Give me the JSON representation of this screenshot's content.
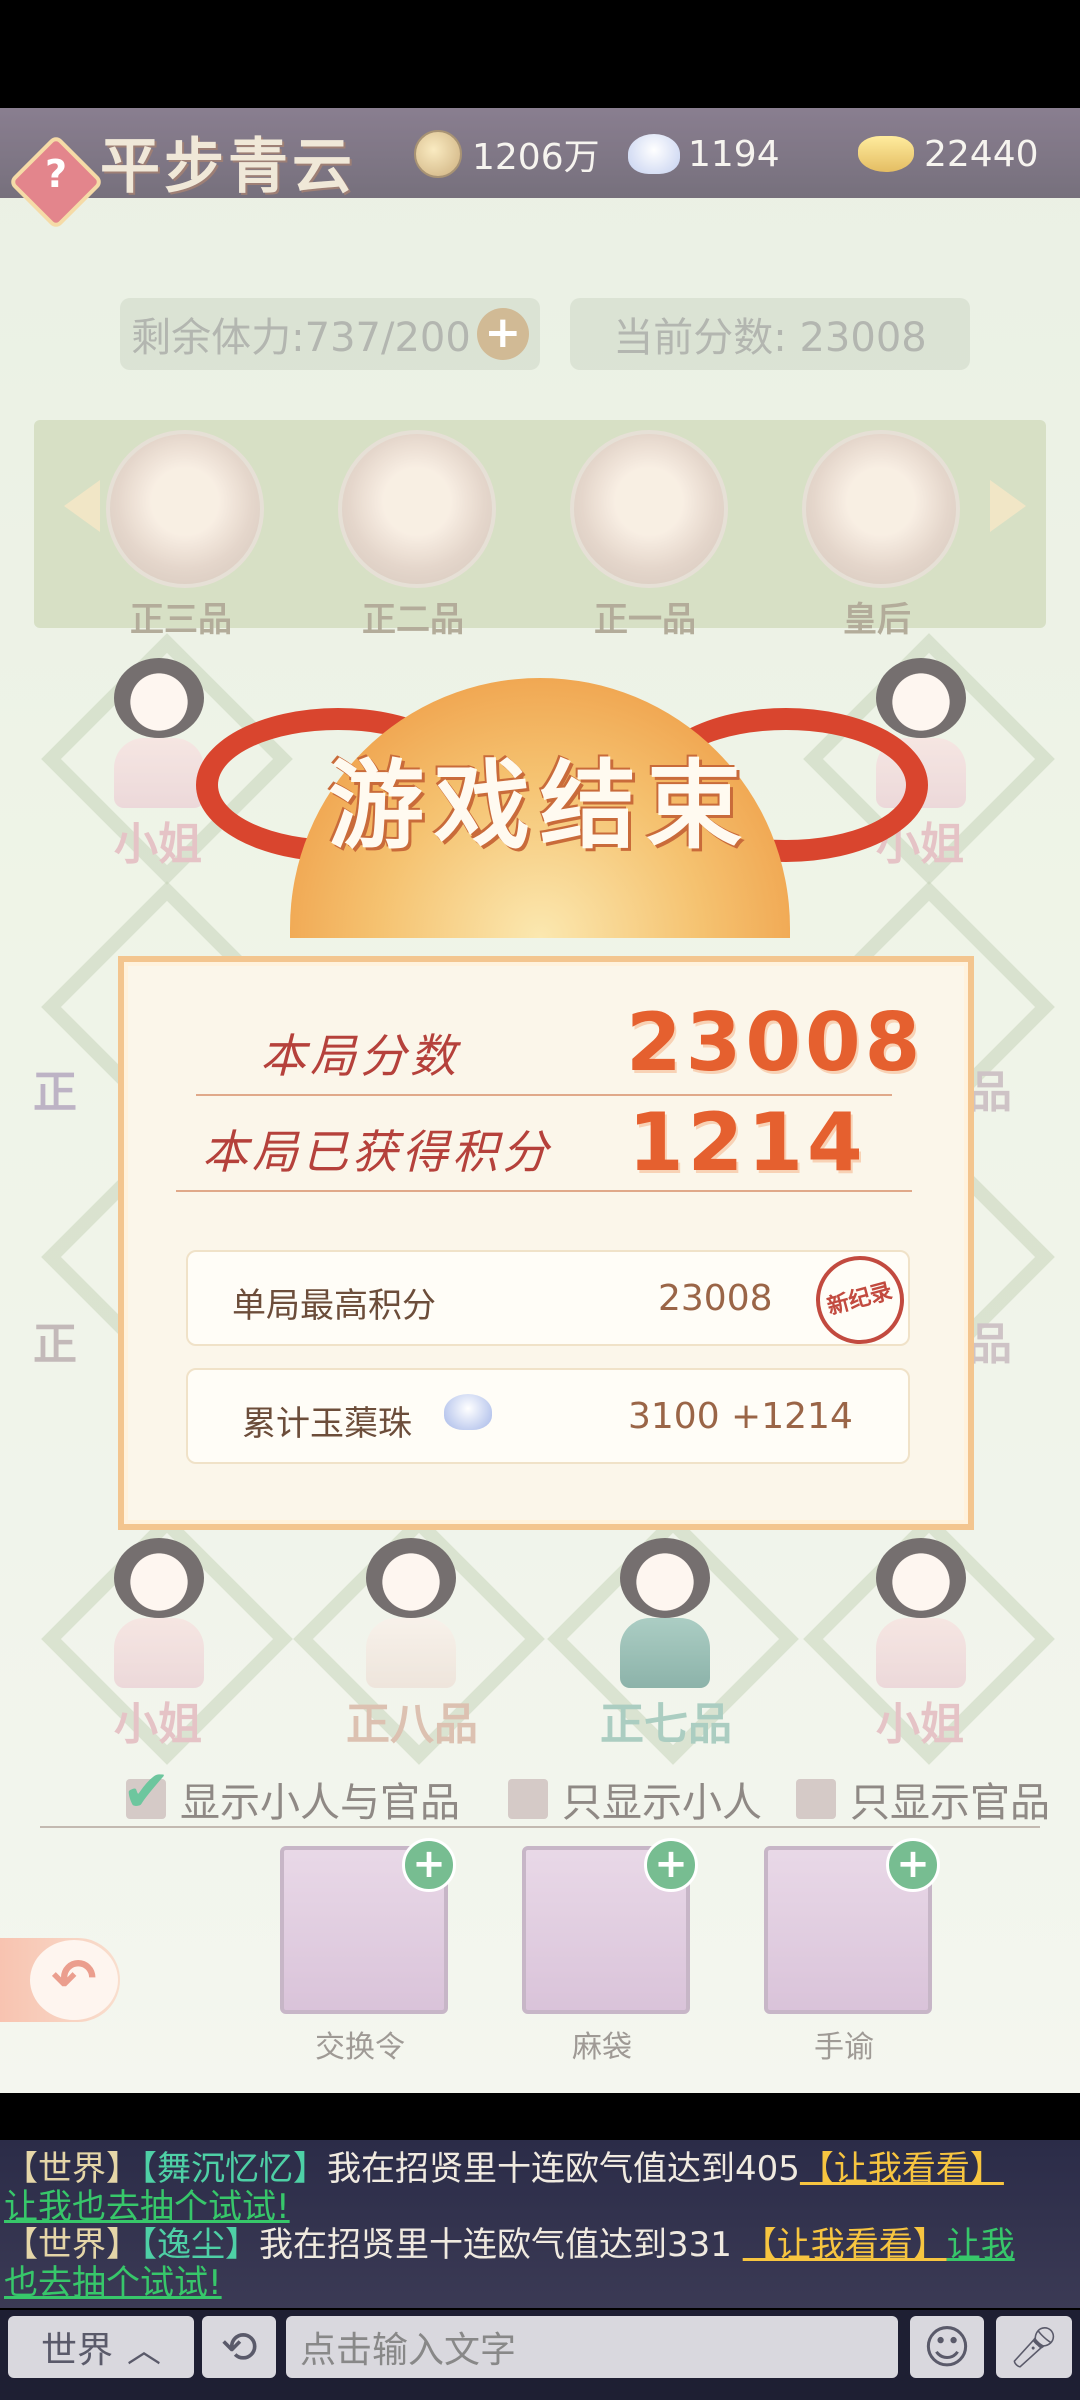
{
  "header": {
    "game_title": "平步青云",
    "help_symbol": "?",
    "resources": [
      {
        "icon": "coin-icon",
        "value": "1206万"
      },
      {
        "icon": "pearl-icon",
        "value": "1194"
      },
      {
        "icon": "gold-ingot-icon",
        "value": "22440"
      }
    ]
  },
  "stats": {
    "stamina": "剩余体力:737/200",
    "current_score": "当前分数: 23008"
  },
  "ranks": [
    "正三品",
    "正二品",
    "正一品",
    "皇后"
  ],
  "board": {
    "row1": [
      "小姐",
      "",
      "",
      "小姐"
    ],
    "row2_left": "正",
    "row2_right": "品",
    "row3_left": "正",
    "row3_right": "品",
    "row4": [
      "小姐",
      "正八品",
      "正七品",
      "小姐"
    ]
  },
  "result": {
    "title": "游戏结束",
    "round_score_label": "本局分数",
    "round_score": "23008",
    "points_label": "本局已获得积分",
    "points": "1214",
    "best_label": "单局最高积分",
    "best_value": "23008",
    "new_record": "新纪录",
    "total_label": "累计玉蕖珠",
    "total_value": "3100 +1214"
  },
  "filters": [
    {
      "label": "显示小人与官品",
      "checked": true
    },
    {
      "label": "只显示小人",
      "checked": false
    },
    {
      "label": "只显示官品",
      "checked": false
    }
  ],
  "items": [
    {
      "label": "交换令",
      "icon": "token-icon"
    },
    {
      "label": "麻袋",
      "icon": "sack-icon"
    },
    {
      "label": "手谕",
      "icon": "scroll-icon"
    }
  ],
  "chat": {
    "line1": {
      "tag": "【世界】",
      "name": "【舞沉忆忆】",
      "text": "我在招贤里十连欧气值达到405",
      "link": "【让我看看】",
      "cta": "让我也去抽个试试!"
    },
    "line2": {
      "tag": "【世界】",
      "name": "【逸尘】",
      "text": "我在招贤里十连欧气值达到331 ",
      "link": "【让我看看】",
      "cta1": "让我",
      "cta2": "也去抽个试试!"
    }
  },
  "input": {
    "channel": "世界",
    "placeholder": "点击输入文字"
  }
}
